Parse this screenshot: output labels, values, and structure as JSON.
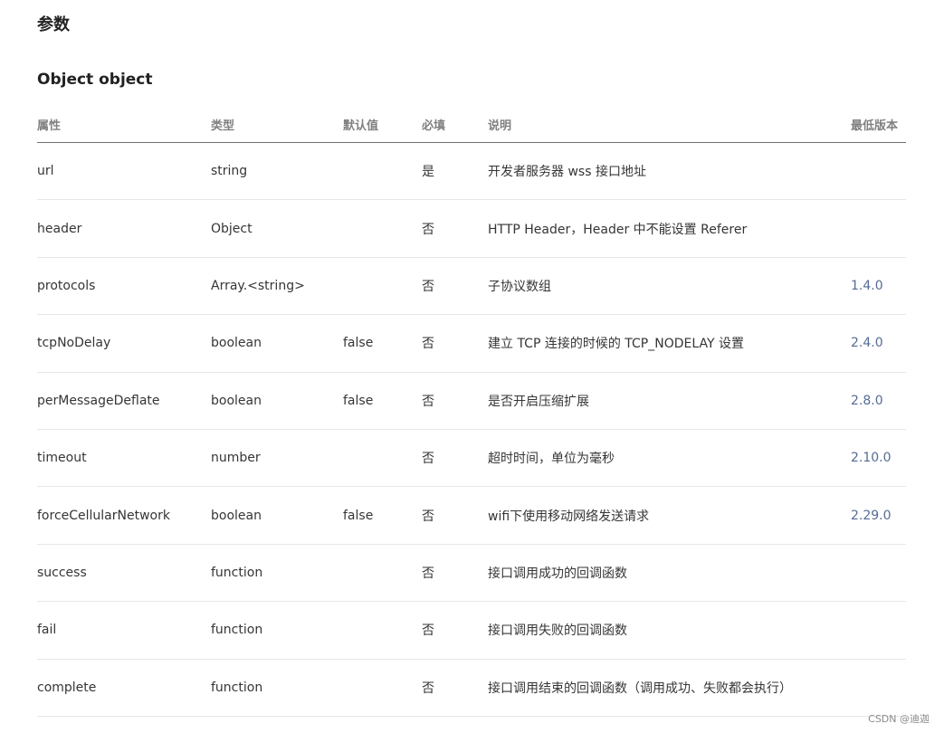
{
  "section_title": "参数",
  "object_title": "Object object",
  "table": {
    "headers": {
      "name": "属性",
      "type": "类型",
      "default": "默认值",
      "required": "必填",
      "description": "说明",
      "version": "最低版本"
    },
    "rows": [
      {
        "name": "url",
        "type": "string",
        "default": "",
        "required": "是",
        "description": "开发者服务器 wss 接口地址",
        "version": ""
      },
      {
        "name": "header",
        "type": "Object",
        "default": "",
        "required": "否",
        "description": "HTTP Header，Header 中不能设置 Referer",
        "version": ""
      },
      {
        "name": "protocols",
        "type": "Array.<string>",
        "default": "",
        "required": "否",
        "description": "子协议数组",
        "version": "1.4.0"
      },
      {
        "name": "tcpNoDelay",
        "type": "boolean",
        "default": "false",
        "required": "否",
        "description": "建立 TCP 连接的时候的 TCP_NODELAY 设置",
        "version": "2.4.0"
      },
      {
        "name": "perMessageDeflate",
        "type": "boolean",
        "default": "false",
        "required": "否",
        "description": "是否开启压缩扩展",
        "version": "2.8.0"
      },
      {
        "name": "timeout",
        "type": "number",
        "default": "",
        "required": "否",
        "description": "超时时间，单位为毫秒",
        "version": "2.10.0"
      },
      {
        "name": "forceCellularNetwork",
        "type": "boolean",
        "default": "false",
        "required": "否",
        "description": "wifi下使用移动网络发送请求",
        "version": "2.29.0"
      },
      {
        "name": "success",
        "type": "function",
        "default": "",
        "required": "否",
        "description": "接口调用成功的回调函数",
        "version": ""
      },
      {
        "name": "fail",
        "type": "function",
        "default": "",
        "required": "否",
        "description": "接口调用失败的回调函数",
        "version": ""
      },
      {
        "name": "complete",
        "type": "function",
        "default": "",
        "required": "否",
        "description": "接口调用结束的回调函数（调用成功、失败都会执行）",
        "version": ""
      }
    ]
  },
  "watermark": "CSDN @迪迦",
  "colors": {
    "version_link": "#576b95",
    "header_text": "#808080",
    "body_text": "#353535"
  }
}
